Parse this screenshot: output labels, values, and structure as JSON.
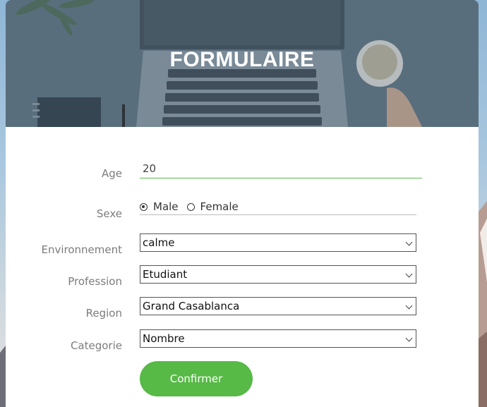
{
  "header": {
    "title": "FORMULAIRE"
  },
  "form": {
    "age": {
      "label": "Age",
      "value": "20"
    },
    "sexe": {
      "label": "Sexe",
      "options": [
        "Male",
        "Female"
      ],
      "selected": "Male"
    },
    "environnement": {
      "label": "Environnement",
      "value": "calme"
    },
    "profession": {
      "label": "Profession",
      "value": "Etudiant"
    },
    "region": {
      "label": "Region",
      "value": "Grand Casablanca"
    },
    "categorie": {
      "label": "Categorie",
      "value": "Nombre"
    },
    "submit_label": "Confirmer"
  },
  "colors": {
    "accent": "#57b946",
    "label": "#7c7c7c",
    "hero_overlay": "#5a6e7c"
  }
}
